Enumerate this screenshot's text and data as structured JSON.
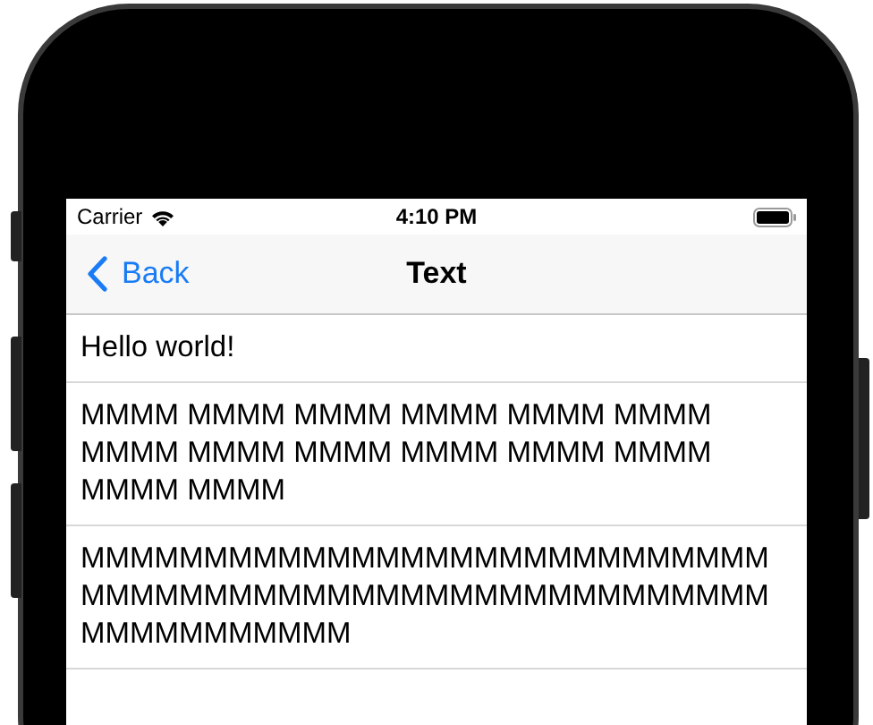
{
  "status_bar": {
    "carrier": "Carrier",
    "time": "4:10 PM"
  },
  "nav_bar": {
    "back": "Back",
    "title": "Text"
  },
  "rows": [
    {
      "text": "Hello world!"
    },
    {
      "text": "MMMM MMMM MMMM MMMM MMMM MMMM MMMM MMMM MMMM MMMM MMMM MMMM MMMM MMMM"
    },
    {
      "text": "MMMMMMMMMMMMMMMMMMMMMMMMMMMMMMMMMMMMMMMMMMMMMMMMMMMMMMMMMMMMMMMMMMM"
    }
  ]
}
